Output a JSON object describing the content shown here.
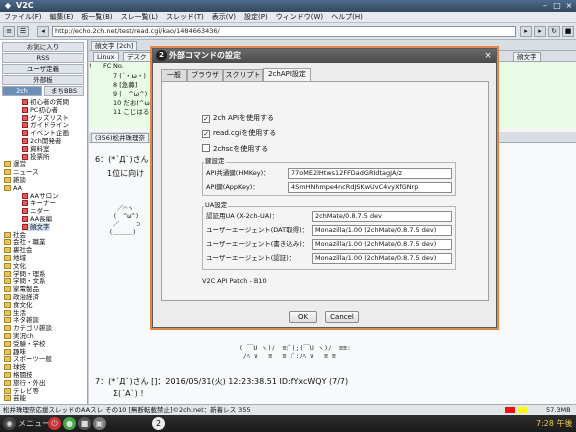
{
  "window": {
    "title": "V2C"
  },
  "menu": [
    "ファイル(F)",
    "編集(E)",
    "板一覧(B)",
    "スレ一覧(L)",
    "スレッド(T)",
    "表示(V)",
    "設定(P)",
    "ウィンドウ(W)",
    "ヘルプ(H)"
  ],
  "toolbar": {
    "url": "http://echo.2ch.net/test/read.cgi/kao/1484663436/"
  },
  "left": {
    "buttons": [
      "お気に入り",
      "RSS",
      "ユーザ定義",
      "外部板"
    ],
    "tabs": [
      "2ch",
      "まちBBS"
    ],
    "tree": [
      "初心者の質問",
      "PC初心者",
      "グッズリスト",
      "ガイドライン",
      "イベント企画",
      "2ch開発者",
      "資料室",
      "投票所",
      "運営",
      "ニュース",
      "雑談",
      "AA",
      "AAサロン",
      "キーナー",
      "ニダー",
      "AA長編",
      "顔文字",
      "社会",
      "会社・職業",
      "裏社会",
      "地域",
      "文化",
      "学問・理系",
      "学問・文系",
      "家電製品",
      "政治経済",
      "食文化",
      "生活",
      "ネタ雑談",
      "カテゴリ雑談",
      "実況ch",
      "受験・学校",
      "趣味",
      "スポーツ一般",
      "球技",
      "格闘技",
      "旅行・外出",
      "テレビ等",
      "芸能"
    ]
  },
  "right": {
    "top_tab": "顔文字 [2ch]",
    "subtabs": [
      "Linux",
      "デスク",
      "顔文字"
    ],
    "columns": [
      "!",
      "FC",
      "No."
    ],
    "rows": [
      "7 (´・ω・)",
      "8 [急募]",
      "9 (　^ω^)",
      "10 だお(^ω",
      "11 こじはる"
    ],
    "thread_tab": "(356)松井珠理奈",
    "post6_head": "6：(*´Д`)さん",
    "post6_body": "1位に向け",
    "post7_head": "7：(*´Д`)さん []：2016/05/31(火) 12:23:38.51 ID:fYxcWQY (7/7)",
    "post7_body": "Σ(´A`)  !"
  },
  "status": {
    "text": "松井珠理奈応援スレッドのAAスレ その10 [無断転載禁止]©2ch.net：新着レス 355",
    "memory": "57.3MB"
  },
  "taskbar": {
    "menu": "メニュー",
    "clock": "7:28 午後"
  },
  "dialog": {
    "title": "外部コマンドの設定",
    "tabs": [
      "一般",
      "ブラウザ",
      "スクリプト",
      "2chAPI設定"
    ],
    "checks": [
      {
        "label": "2ch APIを使用する",
        "checked": true
      },
      {
        "label": "read.cgiを使用する",
        "checked": true
      },
      {
        "label": "2chscを使用する",
        "checked": false
      }
    ],
    "key_group": "鍵設定",
    "key_fields": [
      {
        "label": "API共通鍵(HMKey)：",
        "value": "77oME2lHtws12FFDadGRIdtagJA/z"
      },
      {
        "label": "API鍵(AppKey)：",
        "value": "4SmHNhmpe4ncRdJSKwUvC4vyXfGNrp"
      }
    ],
    "ua_group": "UA設定",
    "ua_fields": [
      {
        "label": "認証用UA (X-2ch-UA)：",
        "value": "2chMate/0.8.7.5 dev"
      },
      {
        "label": "ユーザーエージェント(DAT取得)：",
        "value": "Monazilla/1.00 (2chMate/0.8.7.5 dev)"
      },
      {
        "label": "ユーザーエージェント(書き込み)：",
        "value": "Monazilla/1.00 (2chMate/0.8.7.5 dev)"
      },
      {
        "label": "ユーザーエージェント(認証)：",
        "value": "Monazilla/1.00 (2chMate/0.8.7.5 dev)"
      }
    ],
    "footer": "V2C API Patch - B10",
    "ok": "OK",
    "cancel": "Cancel"
  },
  "colors": {
    "accent": "#e3864a",
    "titlebar": "#33485f",
    "list_bg": "#e8fbe4"
  }
}
